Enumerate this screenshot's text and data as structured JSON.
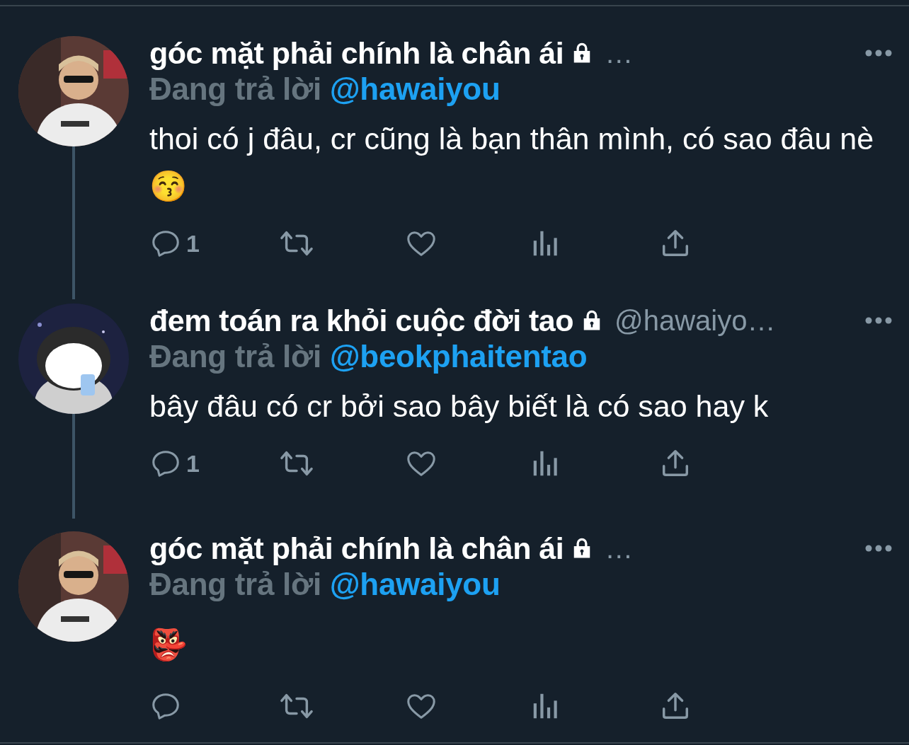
{
  "tweets": [
    {
      "author": "góc mặt phải chính là chân ái",
      "locked": true,
      "handle": "…",
      "reply_label": "Đang trả lời",
      "reply_to": "@hawaiyou",
      "text": "thoi có j đâu, cr cũng là bạn thân mình, có sao đâu nè😚",
      "reply_count": "1",
      "thread_line": true
    },
    {
      "author": "đem toán ra khỏi cuộc đời tao",
      "locked": true,
      "handle": "@hawaiyo…",
      "reply_label": "Đang trả lời",
      "reply_to": "@beokphaitentao",
      "text": "bây đâu có cr bởi sao bây biết là có sao hay k",
      "reply_count": "1",
      "thread_line": true
    },
    {
      "author": "góc mặt phải chính là chân ái",
      "locked": true,
      "handle": "…",
      "reply_label": "Đang trả lời",
      "reply_to": "@hawaiyou",
      "text": "👺",
      "thread_line": false
    }
  ]
}
